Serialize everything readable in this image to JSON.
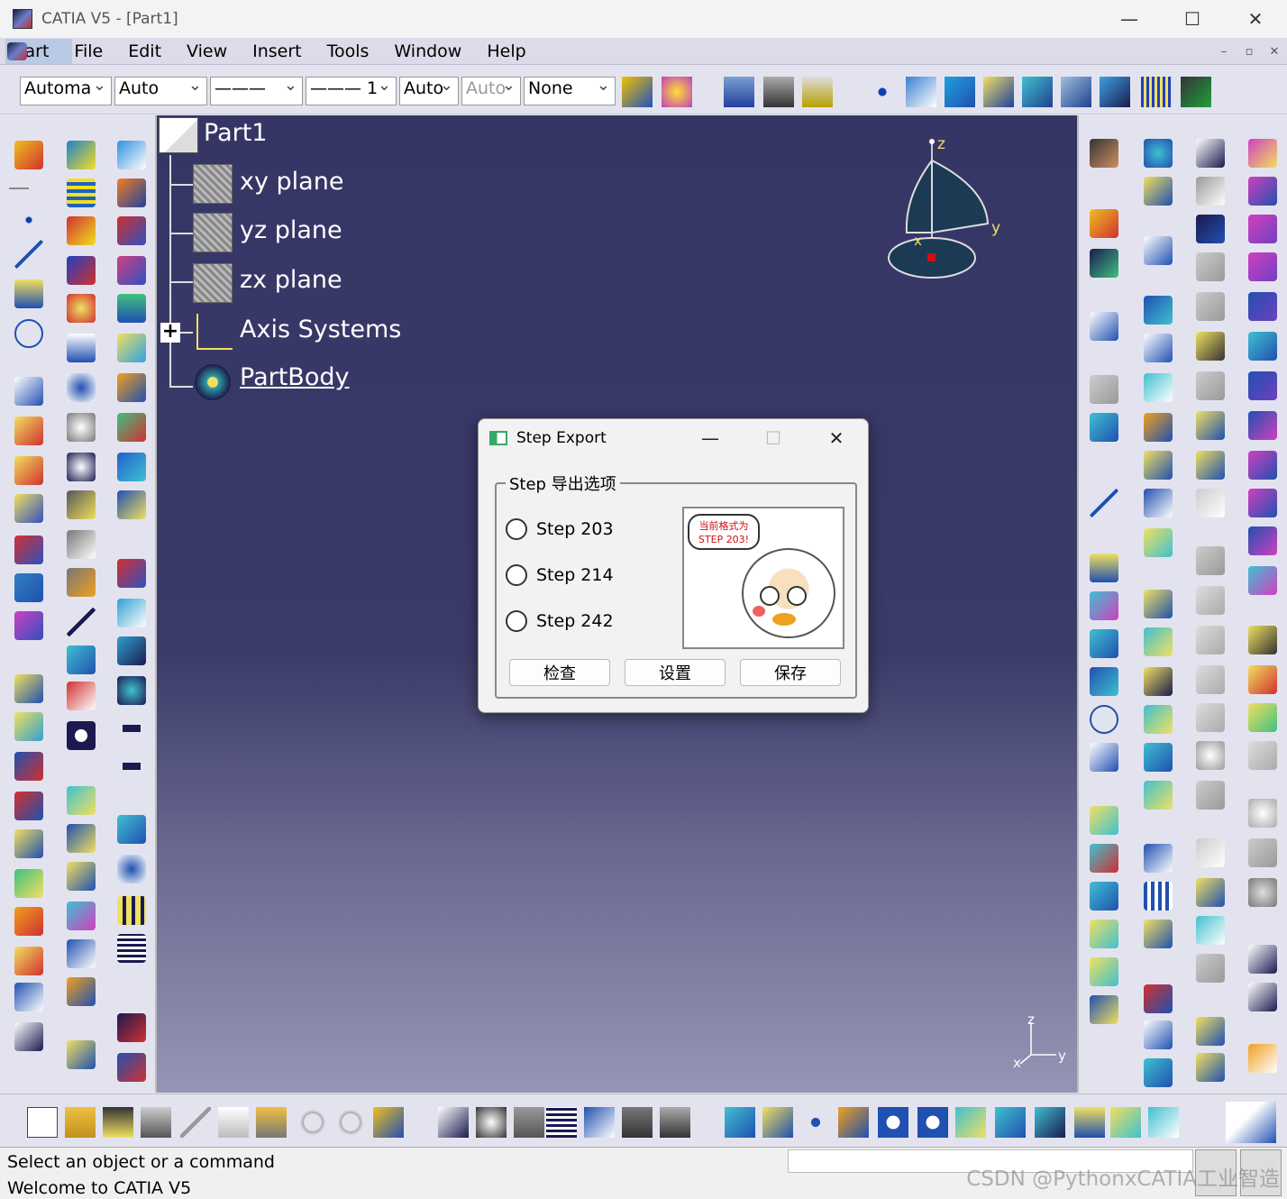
{
  "window": {
    "title": "CATIA V5 - [Part1]",
    "min": "—",
    "max": "☐",
    "close": "✕"
  },
  "menu": {
    "start": "Start",
    "items": [
      "File",
      "Edit",
      "View",
      "Insert",
      "Tools",
      "Window",
      "Help"
    ],
    "mdi_min": "–",
    "mdi_restore": "▫",
    "mdi_close": "✕"
  },
  "toolbar": {
    "combos": [
      "Automa",
      "Auto",
      "———",
      "——— 1",
      "Auto",
      "Auto",
      "None"
    ]
  },
  "tree": {
    "root": "Part1",
    "items": [
      "xy plane",
      "yz plane",
      "zx plane",
      "Axis Systems",
      "PartBody"
    ],
    "expand": "+"
  },
  "compass": {
    "z": "z",
    "y": "y",
    "x": "x"
  },
  "axis_small": {
    "z": "z",
    "y": "y",
    "x": "x"
  },
  "dialog": {
    "title": "Step Export",
    "group": "Step 导出选项",
    "options": [
      "Step 203",
      "Step 214",
      "Step 242"
    ],
    "bubble_line1": "当前格式为",
    "bubble_line2": "STEP 203!",
    "buttons": [
      "检查",
      "设置",
      "保存"
    ],
    "min": "—",
    "max": "☐",
    "close": "✕"
  },
  "status": {
    "line1": "Select an object or a command",
    "line2": "Welcome to CATIA V5"
  },
  "watermark": "CSDN @PythonxCATIA工业智造",
  "colors": {
    "viewport_top": "#363666",
    "viewport_bottom": "#9595b5",
    "menu_bg": "#dbdbe9"
  }
}
